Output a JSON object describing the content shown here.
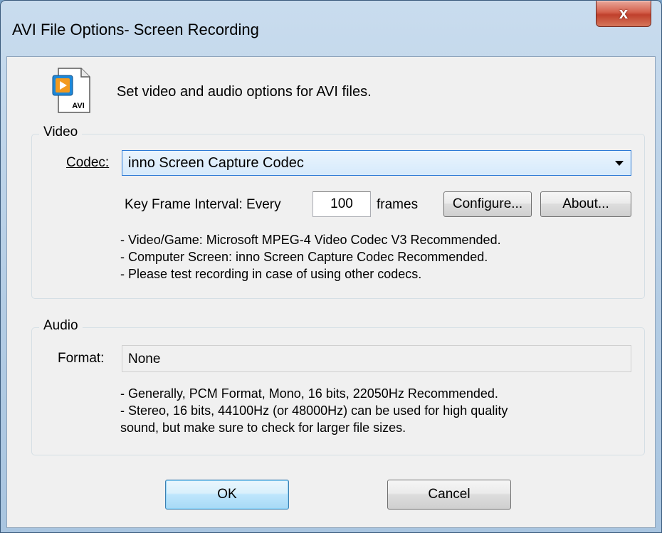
{
  "window": {
    "title": "AVI File Options- Screen Recording",
    "close_glyph": "x"
  },
  "header": {
    "icon": "avi-file-icon",
    "icon_caption": "AVI",
    "text": "Set video and audio options for AVI files."
  },
  "video": {
    "group_label": "Video",
    "codec_label": "Codec:",
    "codec_value": "inno Screen Capture Codec",
    "keyframe_label_prefix": "Key Frame Interval: Every",
    "keyframe_value": "100",
    "keyframe_suffix": "frames",
    "configure_label": "Configure...",
    "about_label": "About...",
    "notes": [
      "- Video/Game: Microsoft MPEG-4 Video Codec V3 Recommended.",
      "- Computer Screen: inno Screen Capture Codec Recommended.",
      "- Please test recording in case of using other codecs."
    ]
  },
  "audio": {
    "group_label": "Audio",
    "format_label": "Format:",
    "format_value": "None",
    "notes": [
      "- Generally, PCM Format, Mono, 16 bits, 22050Hz Recommended.",
      "- Stereo, 16 bits, 44100Hz (or 48000Hz) can be used for high quality",
      "sound, but make sure to check for larger file sizes."
    ]
  },
  "buttons": {
    "ok": "OK",
    "cancel": "Cancel"
  },
  "colors": {
    "accent": "#2c7ad6",
    "close": "#c0402c",
    "client_bg": "#f0f0f0"
  }
}
